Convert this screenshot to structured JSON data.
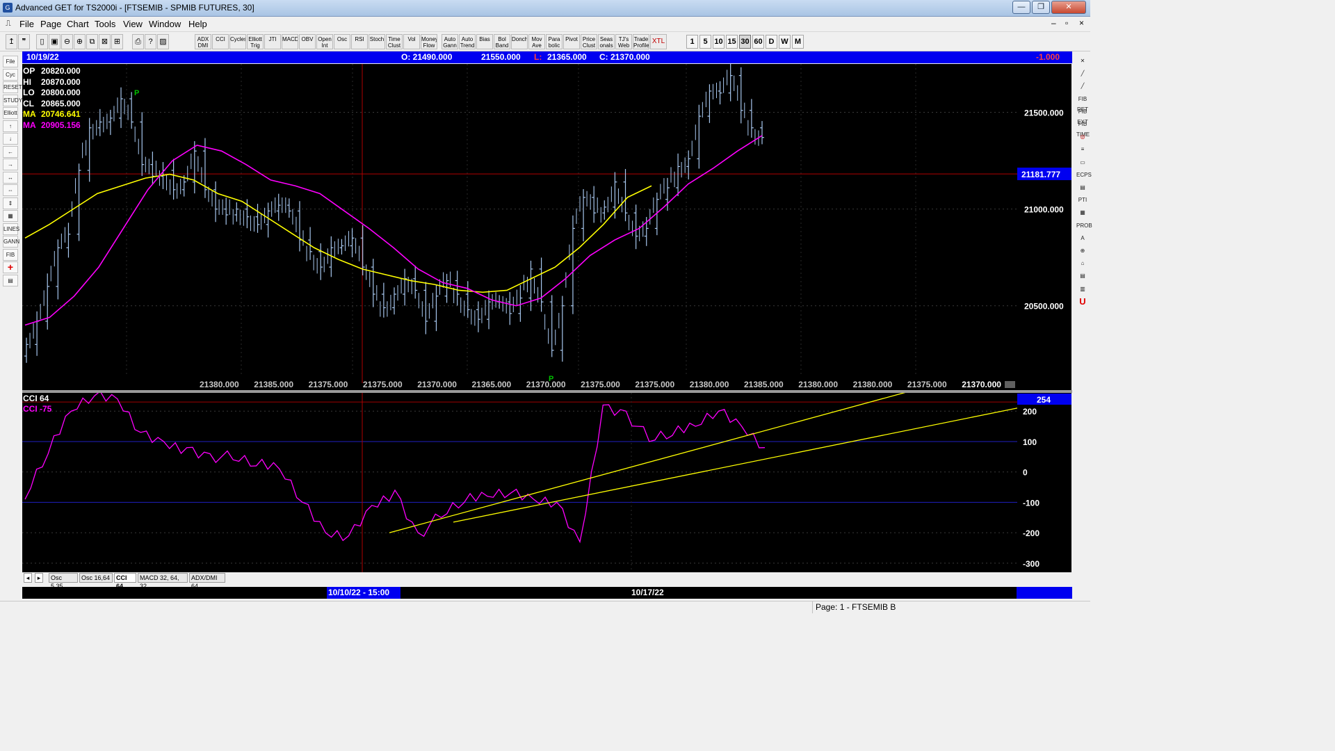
{
  "window": {
    "title": "Advanced GET for TS2000i - [FTSEMIB - SPMIB FUTURES, 30]",
    "app_icon_label": "G",
    "controls": [
      "—",
      "❐",
      "✕"
    ],
    "mdi_controls": [
      "–",
      "▫",
      "×"
    ]
  },
  "menu": [
    "File",
    "Page",
    "Chart",
    "Tools",
    "View",
    "Window",
    "Help"
  ],
  "toolbar": {
    "study_buttons": [
      "ADX DMI",
      "CCI",
      "Cycles",
      "Elliott Trig",
      "JTI",
      "MACD",
      "OBV",
      "Open Int",
      "Osc",
      "RSI",
      "Stoch",
      "Time Clust",
      "Vol",
      "Money Flow",
      "Auto Gann",
      "Auto Trend",
      "Bias",
      "Bol Band",
      "Donch",
      "Mov Ave",
      "Para bolic",
      "Pivot",
      "Price Clust",
      "Seas onals",
      "TJ's Web",
      "Trade Profile",
      "XTL"
    ],
    "interval_buttons": [
      "1",
      "5",
      "10",
      "15",
      "30",
      "60",
      "D",
      "W",
      "M"
    ],
    "active_interval": "30"
  },
  "left_tools": [
    "File",
    "Cyc",
    "RESET",
    "STUDY",
    "Elliott",
    "↑",
    "↓",
    "←",
    "→",
    "↔",
    "⇔",
    "⇕",
    "▦",
    "LINES",
    "GANN",
    "FIB",
    "+",
    "▤"
  ],
  "right_tools": [
    "✕",
    "╱",
    "╱",
    "FIB RET",
    "FIB EXT",
    "FIB TIME",
    "◎",
    "≡",
    "▭",
    "ECPS",
    "▤",
    "PTI",
    "▦",
    "PROB",
    "A",
    "⊕",
    "⌂",
    "▤",
    "▥",
    "U"
  ],
  "info_bar": {
    "date": "10/19/22",
    "open": "O: 21490.000",
    "high": "21550.000",
    "low_label": "L:",
    "low": "21365.000",
    "close": "C: 21370.000",
    "change": "-1.000"
  },
  "ohlc_panel": [
    {
      "label": "OP",
      "value": "20820.000",
      "color": "#ffffff"
    },
    {
      "label": "HI",
      "value": "20870.000",
      "color": "#ffffff"
    },
    {
      "label": "LO",
      "value": "20800.000",
      "color": "#ffffff"
    },
    {
      "label": "CL",
      "value": "20865.000",
      "color": "#ffffff"
    },
    {
      "label": "MA",
      "value": "20746.641",
      "color": "#ffff00"
    },
    {
      "label": "MA",
      "value": "20905.156",
      "color": "#ff00ff"
    }
  ],
  "price_axis": {
    "ticks": [
      "21500.000",
      "21000.000",
      "20500.000"
    ],
    "cursor_price": "21181.777"
  },
  "bottom_values": [
    "21380.000",
    "21385.000",
    "21375.000",
    "21375.000",
    "21370.000",
    "21365.000",
    "21370.000",
    "21375.000",
    "21375.000",
    "21380.000",
    "21385.000",
    "21380.000",
    "21380.000",
    "21375.000",
    "21370.000"
  ],
  "pivot_marker": "P",
  "cci_panel": {
    "title": "CCI 64",
    "value_label": "CCI  -75",
    "current_value": "254",
    "ticks": [
      "200",
      "100",
      "0",
      "-100",
      "-200",
      "-300"
    ]
  },
  "tabs": [
    "Osc 5,35",
    "Osc 16,64",
    "CCI 64",
    "MACD 32, 64, 32",
    "ADX/DMI 64"
  ],
  "active_tab": "CCI 64",
  "time_labels": [
    "10/10/22 - 15:00",
    "10/17/22"
  ],
  "status": "Page: 1 - FTSEMIB B",
  "colors": {
    "chart_bg": "#000000",
    "bars": "#a8c8f0",
    "ma_fast": "#ffff00",
    "ma_slow": "#ff00ff",
    "cci_line": "#ff00ff",
    "trendlines": "#ffff00",
    "cursor": "#b00000",
    "info_bar": "#0000f0"
  },
  "chart_data": [
    {
      "type": "candlestick",
      "title": "FTSEMIB - SPMIB FUTURES, 30",
      "interval": "30 min",
      "ylim": [
        20100,
        21750
      ],
      "yticks": [
        20500,
        21000,
        21500
      ],
      "moving_averages": [
        {
          "name": "MA",
          "color": "#ffff00",
          "last": 20746.641
        },
        {
          "name": "MA",
          "color": "#ff00ff",
          "last": 20905.156
        }
      ],
      "close_series": [
        20300,
        20420,
        20600,
        20800,
        20870,
        21200,
        21420,
        21450,
        21470,
        21570,
        21450,
        21230,
        21170,
        21200,
        21100,
        21140,
        21300,
        21100,
        21000,
        20970,
        21000,
        20960,
        20920,
        20990,
        21020,
        20990,
        20840,
        20780,
        20700,
        20800,
        20810,
        20850,
        20700,
        20560,
        20490,
        20560,
        20640,
        20580,
        20420,
        20550,
        20630,
        20560,
        20480,
        20430,
        20520,
        20520,
        20460,
        20540,
        20690,
        20520,
        20270,
        20500,
        20900,
        21060,
        20980,
        21010,
        21140,
        20980,
        20860,
        20900,
        21050,
        21110,
        21220,
        21260,
        21480,
        21610,
        21600,
        21690,
        21510,
        21420,
        21370
      ],
      "ma_fast_series": [
        20850,
        20920,
        21000,
        21080,
        21120,
        21160,
        21180,
        21150,
        21080,
        21040,
        20960,
        20880,
        20800,
        20740,
        20690,
        20660,
        20630,
        20610,
        20580,
        20570,
        20580,
        20640,
        20700,
        20800,
        20920,
        21060,
        21120
      ],
      "ma_slow_series": [
        20400,
        20440,
        20550,
        20700,
        20900,
        21100,
        21250,
        21330,
        21300,
        21230,
        21150,
        21120,
        21080,
        20990,
        20900,
        20800,
        20690,
        20620,
        20590,
        20530,
        20500,
        20540,
        20640,
        20760,
        20840,
        20900,
        21010,
        21130,
        21210,
        21300,
        21380
      ]
    },
    {
      "type": "line",
      "title": "CCI 64",
      "ylim": [
        -330,
        260
      ],
      "yticks": [
        200,
        100,
        0,
        -100,
        -200,
        -300
      ],
      "series": [
        {
          "name": "CCI",
          "values": [
            -90,
            60,
            200,
            250,
            240,
            130,
            100,
            80,
            60,
            40,
            20,
            10,
            -100,
            -200,
            -210,
            -110,
            -60,
            -200,
            -150,
            -100,
            -80,
            -70,
            -90,
            -100,
            -230,
            220,
            200,
            100,
            120,
            150,
            200,
            150,
            80
          ]
        }
      ],
      "trendlines": [
        {
          "from": [
            -200,
            -200
          ],
          "to": [
            280,
            280
          ]
        },
        {
          "from": [
            -190,
            -190
          ],
          "to": [
            210,
            210
          ]
        }
      ]
    }
  ]
}
